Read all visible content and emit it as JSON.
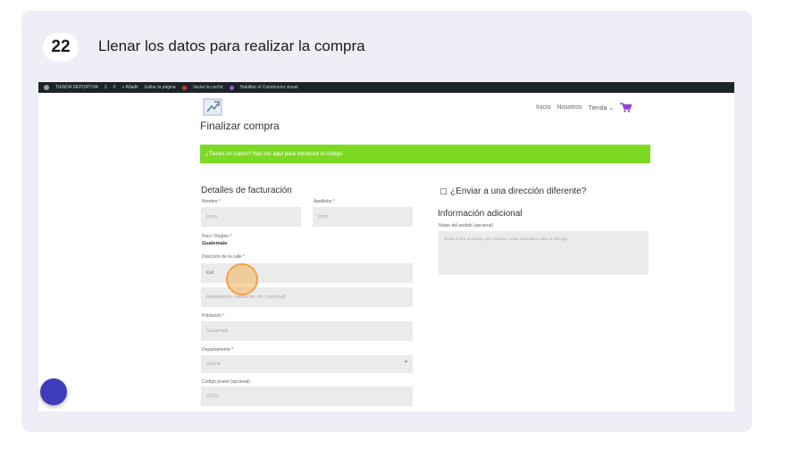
{
  "step": {
    "number": "22",
    "title": "Llenar los datos para realizar la compra"
  },
  "admin_bar": {
    "items": [
      "TIENDA DEPORTIVA",
      "3",
      "0",
      "+ Añadir",
      "Editar la página",
      "Vaciar la caché",
      "Habilitar el Constructor visual"
    ]
  },
  "site_nav": {
    "items": [
      "Inicio",
      "Nosotros",
      "Tienda ⌄"
    ]
  },
  "checkout": {
    "page_title": "Finalizar compra",
    "coupon_notice": "¿Tienes un cupón? Haz clic aquí para introducir tu código",
    "billing_title": "Detalles de facturación",
    "first_name_label": "Nombre",
    "first_name_value": "mario",
    "last_name_label": "Apellidos",
    "last_name_value": "pinto",
    "country_label": "País / Región",
    "country_value": "Guatemala",
    "street_label": "Dirección de la calle",
    "street_value": "Kiel",
    "apartment_placeholder": "Apartamento, habitación, etc. (opcional)",
    "city_label": "Población",
    "city_value": "Guatemala",
    "department_label": "Departamento",
    "department_value": "Quiché",
    "postcode_label": "Código postal (opcional)",
    "postcode_value": "01012",
    "required_mark": "*",
    "ship_different_label": "¿Enviar a una dirección diferente?",
    "additional_info_title": "Información adicional",
    "order_notes_label": "Notas del pedido (opcional)",
    "order_notes_placeholder": "Notas sobre tu pedido, por ejemplo, notas especiales para la entrega."
  },
  "colors": {
    "coupon_bg": "#7cda24",
    "admin_bar_bg": "#1d2327",
    "cart_purple": "#9b3ed8",
    "fab_blue": "#3d3dba",
    "cursor_orange": "#f2a34a"
  }
}
